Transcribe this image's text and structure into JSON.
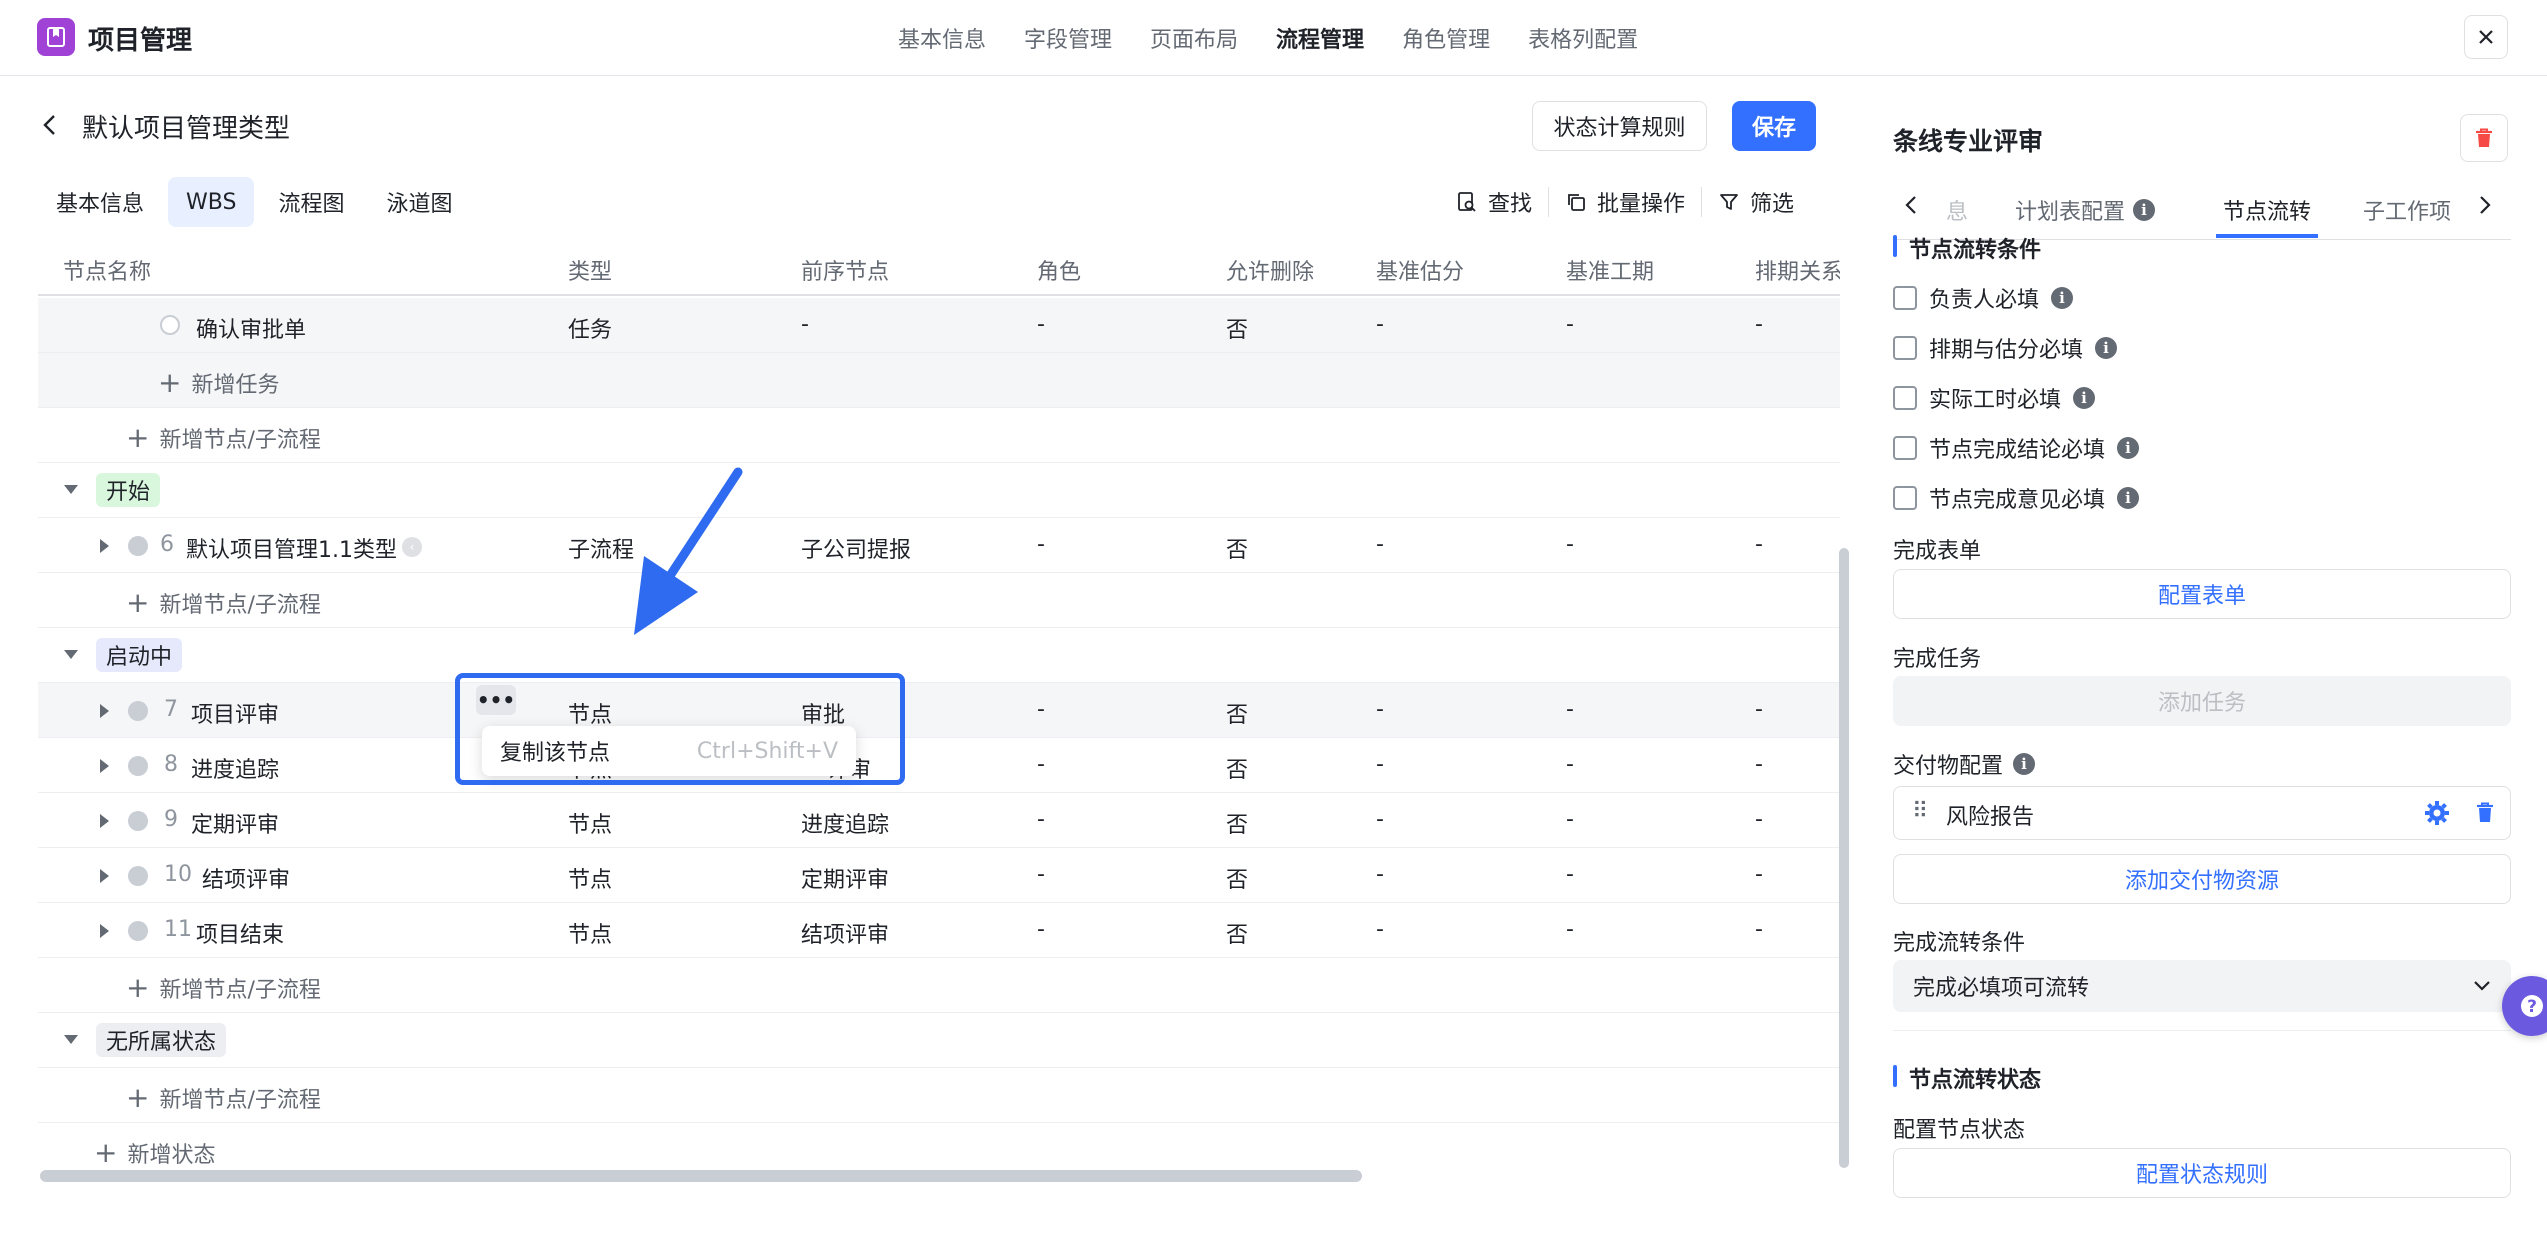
{
  "app": {
    "title": "项目管理"
  },
  "top_tabs": [
    "基本信息",
    "字段管理",
    "页面布局",
    "流程管理",
    "角色管理",
    "表格列配置"
  ],
  "header": {
    "title": "默认项目管理类型",
    "rule_button": "状态计算规则",
    "save_button": "保存"
  },
  "sub_tabs": [
    "基本信息",
    "WBS",
    "流程图",
    "泳道图"
  ],
  "toolbar": {
    "search": "查找",
    "batch": "批量操作",
    "filter": "筛选"
  },
  "table": {
    "columns": [
      "节点名称",
      "类型",
      "前序节点",
      "角色",
      "允许删除",
      "基准估分",
      "基准工期",
      "排期关系"
    ],
    "confirm_row": {
      "name": "确认审批单",
      "type": "任务",
      "prev": "-",
      "role": "-",
      "deletable": "否",
      "estimate": "-",
      "duration": "-",
      "schedule": "-"
    },
    "add_task": "新增任务",
    "add_node": "新增节点/子流程",
    "add_status": "新增状态",
    "status_start": "开始",
    "status_running": "启动中",
    "status_none": "无所属状态",
    "row6": {
      "num": "6",
      "name": "默认项目管理1.1类型",
      "type": "子流程",
      "prev": "子公司提报",
      "role": "-",
      "deletable": "否",
      "estimate": "-",
      "duration": "-",
      "schedule": "-"
    },
    "row7": {
      "num": "7",
      "name": "项目评审",
      "type": "节点",
      "prev": "审批",
      "role": "-",
      "deletable": "否",
      "estimate": "-",
      "duration": "-",
      "schedule": "-"
    },
    "row8": {
      "num": "8",
      "name": "进度追踪",
      "type": "节点",
      "prev": "评审",
      "role": "-",
      "deletable": "否",
      "estimate": "-",
      "duration": "-",
      "schedule": "-"
    },
    "row9": {
      "num": "9",
      "name": "定期评审",
      "type": "节点",
      "prev": "进度追踪",
      "role": "-",
      "deletable": "否",
      "estimate": "-",
      "duration": "-",
      "schedule": "-"
    },
    "row10": {
      "num": "10",
      "name": "结项评审",
      "type": "节点",
      "prev": "定期评审",
      "role": "-",
      "deletable": "否",
      "estimate": "-",
      "duration": "-",
      "schedule": "-"
    },
    "row11": {
      "num": "11",
      "name": "项目结束",
      "type": "节点",
      "prev": "结项评审",
      "role": "-",
      "deletable": "否",
      "estimate": "-",
      "duration": "-",
      "schedule": "-"
    }
  },
  "popup": {
    "more": "•••",
    "label": "复制该节点",
    "shortcut": "Ctrl+Shift+V"
  },
  "right_panel": {
    "title": "条线专业评审",
    "tabs": {
      "partial": "息",
      "plan": "计划表配置",
      "flow": "节点流转",
      "sub": "子工作项"
    },
    "section_conditions": "节点流转条件",
    "checks": [
      "负责人必填",
      "排期与估分必填",
      "实际工时必填",
      "节点完成结论必填",
      "节点完成意见必填"
    ],
    "complete_form_label": "完成表单",
    "config_form_button": "配置表单",
    "complete_task_label": "完成任务",
    "add_task_button": "添加任务",
    "deliverable_label": "交付物配置",
    "deliverable_item": "风险报告",
    "add_deliverable_button": "添加交付物资源",
    "flow_condition_label": "完成流转条件",
    "flow_condition_value": "完成必填项可流转",
    "section_status": "节点流转状态",
    "config_status_label": "配置节点状态",
    "config_status_button": "配置状态规则"
  },
  "colors": {
    "accent": "#3370ff",
    "logo": "#a042d6",
    "tag_start": "#d9f7dc",
    "tag_running": "#e5e9fb",
    "tag_none": "#eceef1",
    "delete": "#f54a45"
  }
}
